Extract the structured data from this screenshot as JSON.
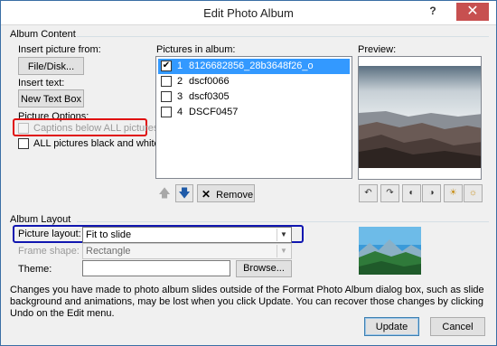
{
  "window": {
    "title": "Edit Photo Album",
    "help": "?",
    "close": "✕"
  },
  "album_content": {
    "group_title": "Album Content",
    "insert_picture_from": "Insert picture from:",
    "file_disk_button": "File/Disk...",
    "insert_text": "Insert text:",
    "new_text_box_button": "New Text Box",
    "picture_options": "Picture Options:",
    "captions_label": "Captions below ALL pictures",
    "captions_checked": false,
    "captions_enabled": false,
    "black_white_label": "ALL pictures black and white",
    "black_white_checked": false
  },
  "pictures": {
    "label": "Pictures in album:",
    "items": [
      {
        "num": "1",
        "name": "8126682856_28b3648f26_o",
        "checked": true,
        "selected": true
      },
      {
        "num": "2",
        "name": "dscf0066",
        "checked": false,
        "selected": false
      },
      {
        "num": "3",
        "name": "dscf0305",
        "checked": false,
        "selected": false
      },
      {
        "num": "4",
        "name": "DSCF0457",
        "checked": false,
        "selected": false
      }
    ],
    "remove_button": "Remove",
    "up_icon": "arrow-up-icon",
    "down_icon": "arrow-down-icon"
  },
  "preview": {
    "label": "Preview:"
  },
  "album_layout": {
    "group_title": "Album Layout",
    "picture_layout_label": "Picture layout:",
    "picture_layout_value": "Fit to slide",
    "frame_shape_label": "Frame shape:",
    "frame_shape_value": "Rectangle",
    "theme_label": "Theme:",
    "theme_value": "",
    "browse_button": "Browse..."
  },
  "info_text": "Changes you have made to photo album slides outside of the Format Photo Album dialog box, such as slide background and animations, may be lost when you click Update. You can recover those changes by clicking Undo on the Edit menu.",
  "footer": {
    "update_button": "Update",
    "cancel_button": "Cancel"
  },
  "colors": {
    "selection": "#3399ff",
    "highlight_red": "#e01010",
    "highlight_blue": "#1016b0",
    "close_button": "#c75050"
  }
}
